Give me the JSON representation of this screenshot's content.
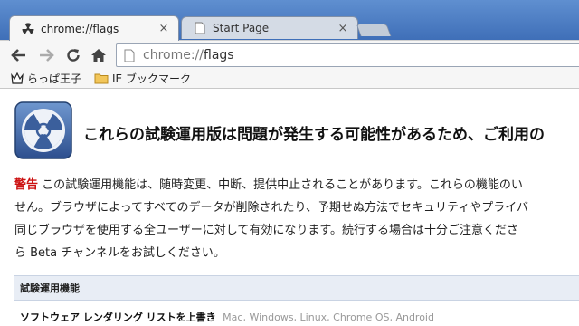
{
  "tabs": [
    {
      "title": "chrome://flags",
      "close": "×"
    },
    {
      "title": "Start Page",
      "close": "×"
    }
  ],
  "address_bar": {
    "scheme": "chrome://",
    "path": "flags"
  },
  "bookmarks": [
    {
      "label": "らっぱ王子",
      "icon": "crown-icon"
    },
    {
      "label": "IE ブックマーク",
      "icon": "folder-icon"
    }
  ],
  "page": {
    "headline": "これらの試験運用版は問題が発生する可能性があるため、ご利用の",
    "warning_label": "警告",
    "warning_lines": [
      " この試験運用機能は、随時変更、中断、提供中止されることがあります。これらの機能のい",
      "せん。ブラウザによってすべてのデータが削除されたり、予期せぬ方法でセキュリティやプライバ",
      "同じブラウザを使用する全ユーザーに対して有効になります。続行する場合は十分ご注意くださ",
      "ら Beta チャンネルをお試しください。"
    ],
    "section_title": "試験運用機能",
    "experiment": {
      "name": "ソフトウェア レンダリング リストを上書き",
      "platforms": "Mac, Windows, Linux, Chrome OS, Android"
    }
  },
  "colors": {
    "accent": "#3f6fb8",
    "warning": "#cc1111",
    "section_bg": "#e8edf5"
  }
}
